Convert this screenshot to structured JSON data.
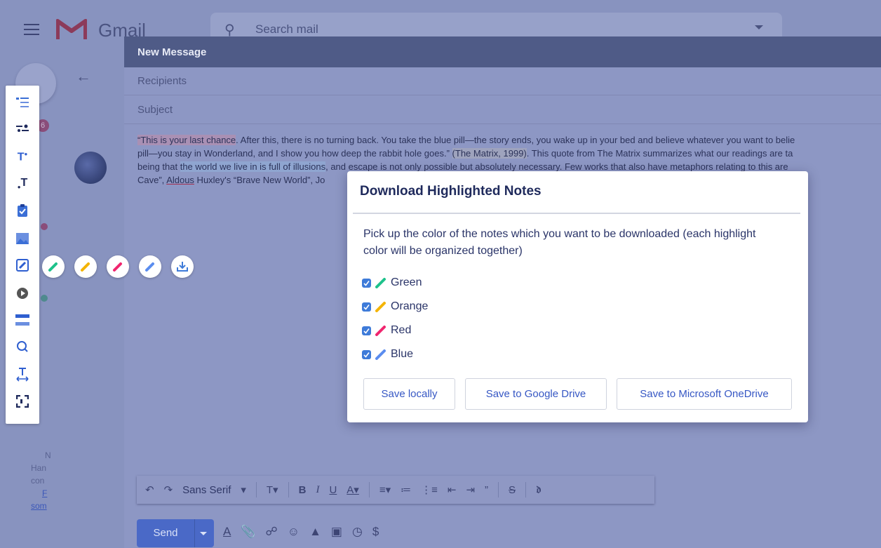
{
  "gmail": {
    "logo_word": "Gmail",
    "search_placeholder": "Search mail",
    "badge_count": "6",
    "side_text_lines": [
      "N",
      "Han",
      "con",
      "F",
      "som"
    ]
  },
  "compose": {
    "title": "New Message",
    "recipients_placeholder": "Recipients",
    "subject_placeholder": "Subject",
    "body": {
      "line1_hl": "“This is your last chance",
      "line1_rest": ". After this, there is no turning back. You take the blue pill—the story ends, you wake up in your bed and believe whatever you want to belie",
      "line2_a": "pill—you stay in Wonderland, and I show you how deep the rabbit hole goes.” ",
      "line2_hl": "(The Matrix, 1999)",
      "line2_b": ". This quote from The Matrix summarizes what our readings are ta",
      "line3_a": "being that ",
      "line3_hl": "the world we live in is full of illusions",
      "line3_b": ", and escape is not only possible but absolutely necessary. Few works that also have metaphors relating to this are",
      "line4_a": "Cave”, ",
      "line4_u": "Aldous",
      "line4_b": " Huxley's “Brave New World”, Jo"
    },
    "font_name": "Sans Serif",
    "send_label": "Send"
  },
  "modal": {
    "title": "Download Highlighted Notes",
    "description": "Pick up the color of the notes which you want to be downloaded (each highlight color will be organized together)",
    "colors": [
      {
        "label": "Green",
        "hex": "#1ec28b",
        "checked": true
      },
      {
        "label": "Orange",
        "hex": "#f4b400",
        "checked": true
      },
      {
        "label": "Red",
        "hex": "#f0266f",
        "checked": true
      },
      {
        "label": "Blue",
        "hex": "#5b8def",
        "checked": true
      }
    ],
    "buttons": {
      "save_local": "Save locally",
      "save_gdrive": "Save to Google Drive",
      "save_onedrive": "Save to Microsoft OneDrive"
    }
  },
  "colors": {
    "accent": "#3657c4",
    "title_text": "#1f2a5c",
    "checkbox": "#3e7bd9"
  },
  "icons": {
    "toolbar": [
      "outline-list-icon",
      "toggle-icon",
      "text-size-up-icon",
      "text-size-down-icon",
      "clipboard-check-icon",
      "image-icon",
      "highlighter-pen-icon",
      "play-icon",
      "layout-bar-icon",
      "search-icon",
      "text-width-icon",
      "fullscreen-icon"
    ],
    "pens": [
      "green-pen-icon",
      "orange-pen-icon",
      "red-pen-icon",
      "blue-pen-icon",
      "download-icon"
    ]
  }
}
